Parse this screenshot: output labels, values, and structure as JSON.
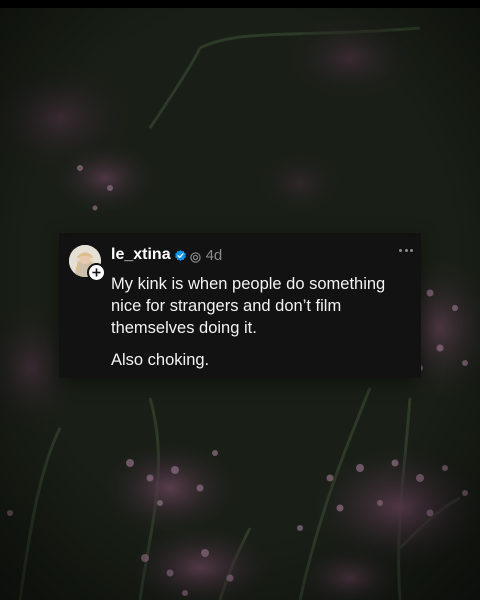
{
  "post": {
    "username": "le_xtina",
    "timestamp": "4d",
    "paragraphs": [
      "My kink is when people do something nice for strangers and don’t film themselves doing it.",
      "Also choking."
    ]
  },
  "icons": {
    "avatar": "profile-photo",
    "verified": "verified-badge-icon",
    "ai": "ai-label-icon",
    "follow": "plus-icon",
    "more": "more-options-icon"
  },
  "colors": {
    "card_background": "#121212",
    "verified_blue": "#0095f6",
    "muted_text": "#8b8b8b",
    "body_text": "#f2f2f2"
  }
}
